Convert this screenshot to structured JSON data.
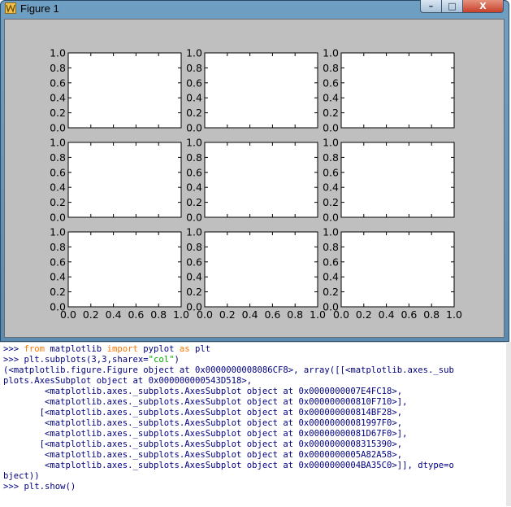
{
  "window": {
    "title": "Figure 1",
    "controls": {
      "minimize": "–",
      "maximize": "□",
      "close": "X"
    }
  },
  "figure": {
    "rows": 3,
    "cols": 3,
    "sharex": "col",
    "y_ticks": [
      "0.0",
      "0.2",
      "0.4",
      "0.6",
      "0.8",
      "1.0"
    ],
    "x_ticks": [
      "0.0",
      "0.2",
      "0.4",
      "0.6",
      "0.8",
      "1.0"
    ],
    "colors": {
      "figure_bg": "#bfbfbf",
      "axes_bg": "#ffffff",
      "axes_edge": "#000000"
    }
  },
  "console": {
    "lines": [
      {
        "parts": [
          {
            "t": ">>> ",
            "c": "prompt"
          },
          {
            "t": "from",
            "c": "kw"
          },
          {
            "t": " matplotlib ",
            "c": "out"
          },
          {
            "t": "import",
            "c": "kw"
          },
          {
            "t": " pyplot ",
            "c": "out"
          },
          {
            "t": "as",
            "c": "kw"
          },
          {
            "t": " plt",
            "c": "out"
          }
        ]
      },
      {
        "parts": [
          {
            "t": ">>> ",
            "c": "prompt"
          },
          {
            "t": "plt.subplots(3,3,sharex=",
            "c": "out"
          },
          {
            "t": "\"col\"",
            "c": "str"
          },
          {
            "t": ")",
            "c": "out"
          }
        ]
      },
      {
        "parts": [
          {
            "t": "(<matplotlib.figure.Figure object at 0x0000000008086CF8>, array([[<matplotlib.axes._sub",
            "c": "out"
          }
        ]
      },
      {
        "parts": [
          {
            "t": "plots.AxesSubplot object at 0x000000000543D518>,",
            "c": "out"
          }
        ]
      },
      {
        "parts": [
          {
            "t": "        <matplotlib.axes._subplots.AxesSubplot object at 0x0000000007E4FC18>,",
            "c": "out"
          }
        ]
      },
      {
        "parts": [
          {
            "t": "        <matplotlib.axes._subplots.AxesSubplot object at 0x000000000810F710>],",
            "c": "out"
          }
        ]
      },
      {
        "parts": [
          {
            "t": "       [<matplotlib.axes._subplots.AxesSubplot object at 0x000000000814BF28>,",
            "c": "out"
          }
        ]
      },
      {
        "parts": [
          {
            "t": "        <matplotlib.axes._subplots.AxesSubplot object at 0x00000000081997F0>,",
            "c": "out"
          }
        ]
      },
      {
        "parts": [
          {
            "t": "        <matplotlib.axes._subplots.AxesSubplot object at 0x00000000081D67F0>],",
            "c": "out"
          }
        ]
      },
      {
        "parts": [
          {
            "t": "       [<matplotlib.axes._subplots.AxesSubplot object at 0x0000000008315390>,",
            "c": "out"
          }
        ]
      },
      {
        "parts": [
          {
            "t": "        <matplotlib.axes._subplots.AxesSubplot object at 0x0000000005A82A58>,",
            "c": "out"
          }
        ]
      },
      {
        "parts": [
          {
            "t": "        <matplotlib.axes._subplots.AxesSubplot object at 0x0000000004BA35C0>]], dtype=o",
            "c": "out"
          }
        ]
      },
      {
        "parts": [
          {
            "t": "bject))",
            "c": "out"
          }
        ]
      },
      {
        "parts": [
          {
            "t": ">>> ",
            "c": "prompt"
          },
          {
            "t": "plt.show()",
            "c": "out"
          }
        ]
      }
    ]
  }
}
